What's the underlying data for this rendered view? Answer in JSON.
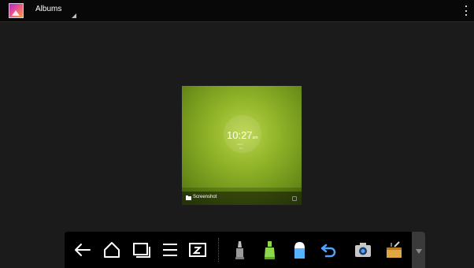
{
  "action_bar": {
    "title": "Albums",
    "app_icon": "gallery-icon",
    "overflow_icon": "overflow-menu-icon"
  },
  "album": {
    "name": "Screenshot",
    "thumbnail": {
      "clock_time": "10:27",
      "clock_ampm": "am"
    }
  },
  "nav_bar": {
    "buttons": [
      "back-icon",
      "home-icon",
      "recent-apps-icon",
      "menu-icon",
      "screenshot-icon",
      "brush-icon",
      "highlighter-icon",
      "eraser-icon",
      "undo-icon",
      "camera-icon",
      "toolbox-icon"
    ]
  },
  "colors": {
    "background": "#1b1b1b",
    "action_bar": "#080808",
    "accent_blue": "#4da3ff",
    "highlighter_green": "#8dd84a"
  }
}
